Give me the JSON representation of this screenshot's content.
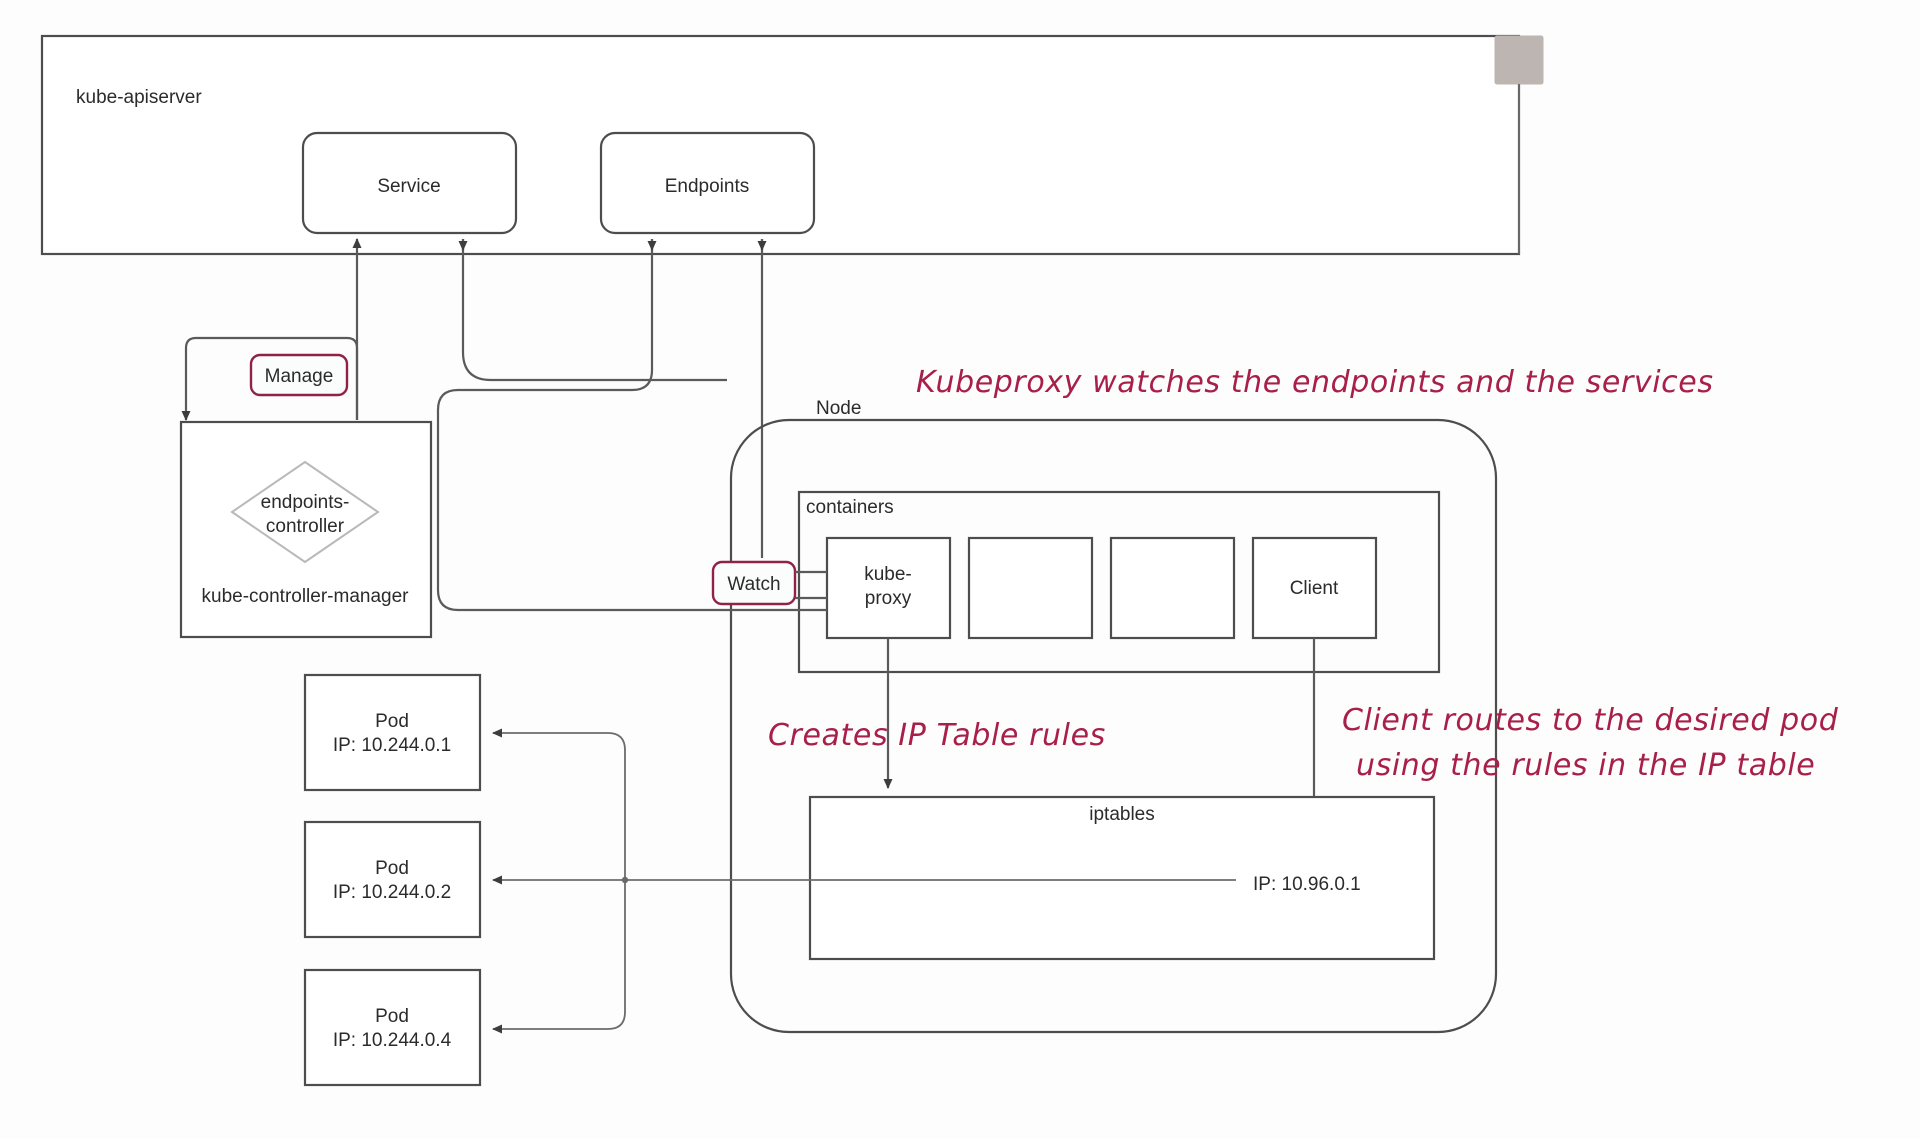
{
  "diagram": {
    "title_hidden": "Kubernetes kube-proxy service routing diagram",
    "apiserver": {
      "label": "kube-apiserver",
      "children": [
        {
          "id": "service",
          "label": "Service"
        },
        {
          "id": "endpoints",
          "label": "Endpoints"
        }
      ]
    },
    "controller_manager": {
      "label": "kube-controller-manager",
      "inner_label_line1": "endpoints-",
      "inner_label_line2": "controller"
    },
    "tags": [
      {
        "id": "manage",
        "label": "Manage"
      },
      {
        "id": "watch",
        "label": "Watch"
      }
    ],
    "node": {
      "label": "Node",
      "containers": {
        "label": "containers",
        "items": [
          {
            "id": "kube-proxy",
            "line1": "kube-",
            "line2": "proxy"
          },
          {
            "id": "container-empty-1",
            "line1": "",
            "line2": ""
          },
          {
            "id": "container-empty-2",
            "line1": "",
            "line2": ""
          },
          {
            "id": "client",
            "line1": "Client",
            "line2": ""
          }
        ]
      },
      "iptables": {
        "label": "iptables",
        "ip_label": "IP: 10.96.0.1"
      }
    },
    "pods": [
      {
        "id": "pod-1",
        "name": "Pod",
        "ip": "IP: 10.244.0.1"
      },
      {
        "id": "pod-2",
        "name": "Pod",
        "ip": "IP: 10.244.0.2"
      },
      {
        "id": "pod-3",
        "name": "Pod",
        "ip": "IP: 10.244.0.4"
      }
    ],
    "annotations": [
      {
        "id": "note-kubeproxy-watch",
        "text": "Kubeproxy watches the endpoints and the services"
      },
      {
        "id": "note-creates-rules",
        "text": "Creates IP Table rules"
      },
      {
        "id": "note-client-routes-line1",
        "text": "Client routes to the desired pod"
      },
      {
        "id": "note-client-routes-line2",
        "text": "using the rules in the IP table"
      }
    ],
    "colors": {
      "annotation": "#a8204a",
      "tag_border": "#8e2347",
      "box_stroke": "#4d4d4d",
      "gray_square": "#bdb5b2"
    }
  }
}
